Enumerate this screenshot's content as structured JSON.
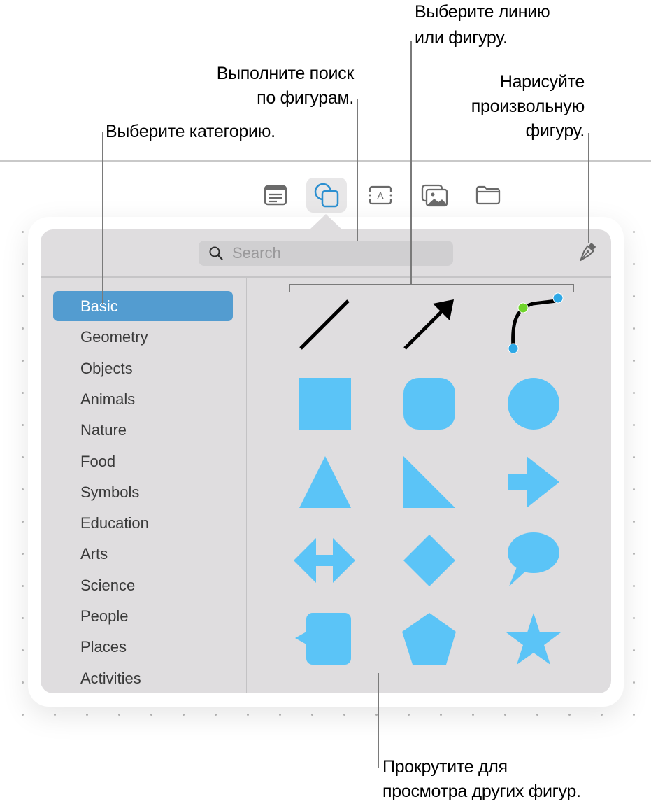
{
  "callouts": {
    "category": "Выберите категорию.",
    "search_line1": "Выполните поиск",
    "search_line2": "по фигурам.",
    "shape_line1": "Выберите линию",
    "shape_line2": "или фигуру.",
    "draw_line1": "Нарисуйте",
    "draw_line2": "произвольную",
    "draw_line3": "фигуру.",
    "scroll_line1": "Прокрутите для",
    "scroll_line2": "просмотра других фигур."
  },
  "toolbar": {
    "buttons": [
      {
        "name": "text-box",
        "icon": "text-box-icon",
        "active": false
      },
      {
        "name": "shapes",
        "icon": "shapes-icon",
        "active": true
      },
      {
        "name": "text",
        "icon": "text-frame-icon",
        "active": false
      },
      {
        "name": "media",
        "icon": "photos-icon",
        "active": false
      },
      {
        "name": "files",
        "icon": "folder-icon",
        "active": false
      }
    ]
  },
  "popover": {
    "search": {
      "placeholder": "Search",
      "value": ""
    },
    "draw_tool": "pen-icon",
    "categories": [
      {
        "label": "Basic",
        "selected": true
      },
      {
        "label": "Geometry",
        "selected": false
      },
      {
        "label": "Objects",
        "selected": false
      },
      {
        "label": "Animals",
        "selected": false
      },
      {
        "label": "Nature",
        "selected": false
      },
      {
        "label": "Food",
        "selected": false
      },
      {
        "label": "Symbols",
        "selected": false
      },
      {
        "label": "Education",
        "selected": false
      },
      {
        "label": "Arts",
        "selected": false
      },
      {
        "label": "Science",
        "selected": false
      },
      {
        "label": "People",
        "selected": false
      },
      {
        "label": "Places",
        "selected": false
      },
      {
        "label": "Activities",
        "selected": false
      }
    ],
    "shapes": [
      "line",
      "arrow-line",
      "curve",
      "square",
      "rounded-square",
      "circle",
      "triangle",
      "right-triangle",
      "arrow-right",
      "double-arrow",
      "diamond",
      "speech-bubble",
      "callout-square",
      "pentagon",
      "star"
    ],
    "colors": {
      "shape_fill": "#5bc4f7",
      "line": "#000000",
      "handle_blue": "#2ea8e6",
      "handle_green": "#6fd42b",
      "selected_category": "#539cd0",
      "active_icon": "#2b8fd0"
    }
  }
}
